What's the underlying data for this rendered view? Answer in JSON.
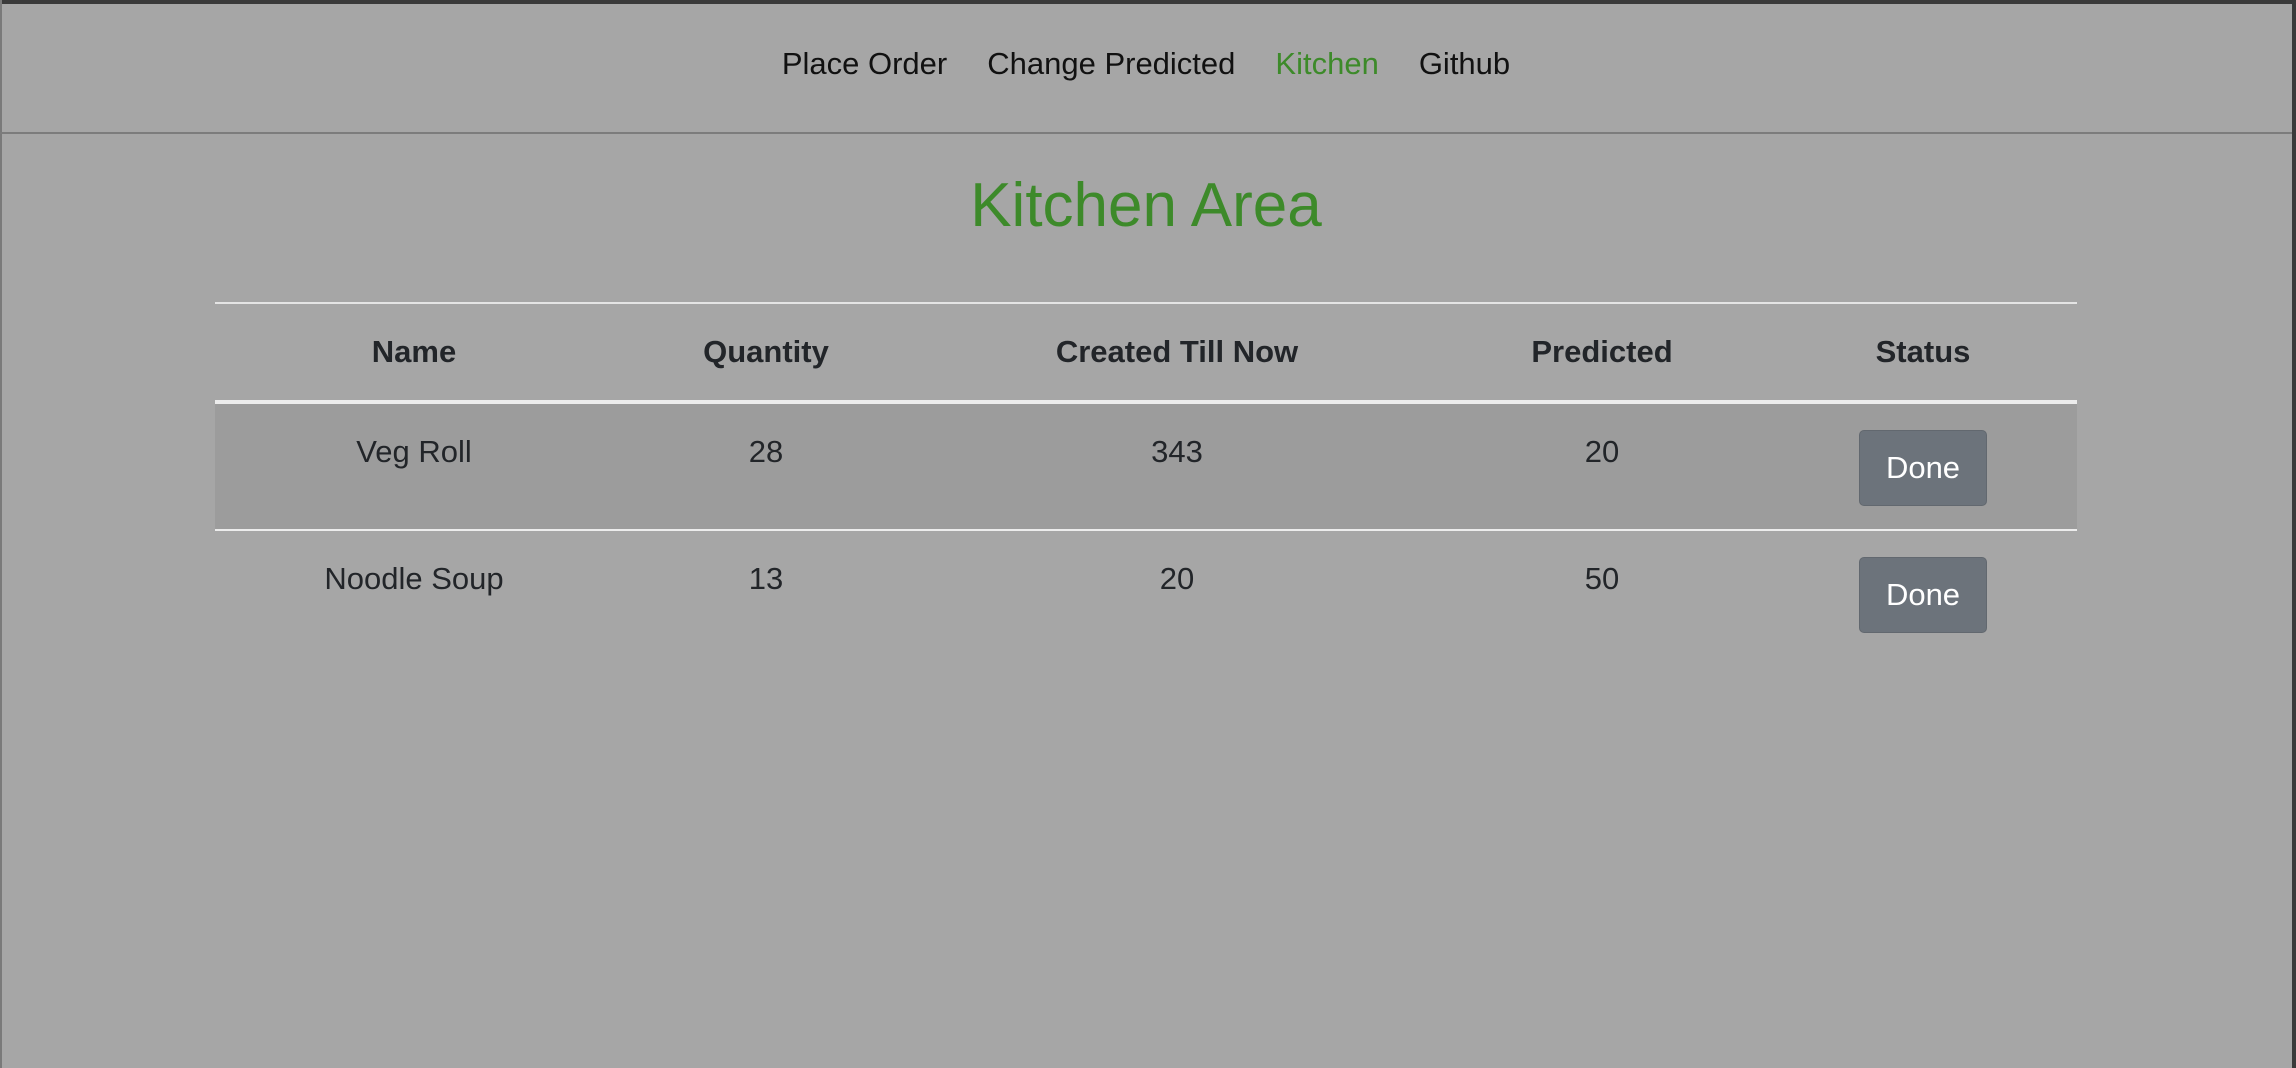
{
  "nav": {
    "items": [
      {
        "label": "Place Order",
        "active": false
      },
      {
        "label": "Change Predicted",
        "active": false
      },
      {
        "label": "Kitchen",
        "active": true
      },
      {
        "label": "Github",
        "active": false
      }
    ]
  },
  "page": {
    "title": "Kitchen Area"
  },
  "table": {
    "columns": [
      "Name",
      "Quantity",
      "Created Till Now",
      "Predicted",
      "Status"
    ],
    "rows": [
      {
        "name": "Veg Roll",
        "quantity": "28",
        "created": "343",
        "predicted": "20",
        "status_button": "Done"
      },
      {
        "name": "Noodle Soup",
        "quantity": "13",
        "created": "20",
        "predicted": "50",
        "status_button": "Done"
      }
    ]
  },
  "colors": {
    "background": "#a6a6a6",
    "accent": "#3d8a2a",
    "button": "#6c737b",
    "stripe": "#9c9c9c"
  }
}
